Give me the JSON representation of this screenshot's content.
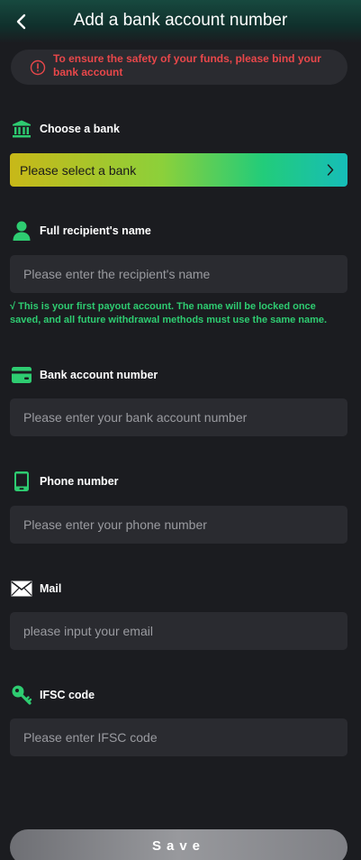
{
  "header": {
    "title": "Add a bank account number"
  },
  "warning": {
    "text": "To ensure the safety of your funds, please bind your bank account"
  },
  "bank": {
    "label": "Choose a bank",
    "select_text": "Please select a bank"
  },
  "recipient": {
    "label": "Full recipient's name",
    "placeholder": "Please enter the recipient's name",
    "hint": "√ This is your first payout account. The name will be locked once saved, and all future withdrawal methods must use the same name."
  },
  "account": {
    "label": "Bank account number",
    "placeholder": "Please enter your bank account number"
  },
  "phone": {
    "label": "Phone number",
    "placeholder": "Please enter your phone number"
  },
  "mail": {
    "label": "Mail",
    "placeholder": "please input your email"
  },
  "ifsc": {
    "label": "IFSC code",
    "placeholder": "Please enter IFSC code"
  },
  "save": {
    "label": "Save"
  },
  "colors": {
    "accent": "#2ecc71",
    "warning": "#e8474a",
    "background": "#1b1c20",
    "field": "#2a2b30"
  },
  "icons": {
    "back": "chevron-left-icon",
    "warning": "alert-circle-icon",
    "bank": "bank-building-icon",
    "recipient": "person-icon",
    "account": "credit-card-icon",
    "phone": "phone-icon",
    "mail": "envelope-icon",
    "ifsc": "key-icon",
    "select": "chevron-right-icon"
  }
}
